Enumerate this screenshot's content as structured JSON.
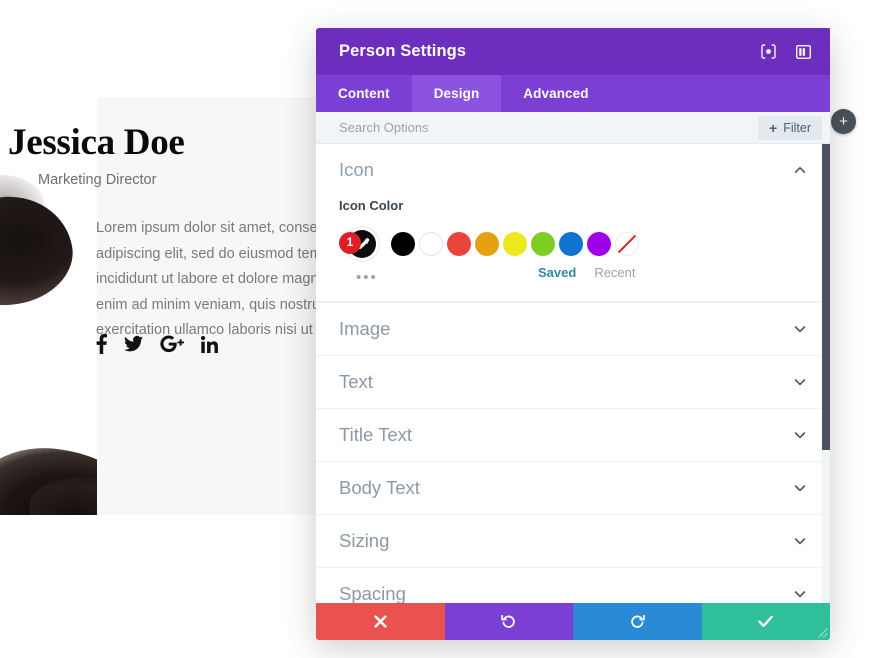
{
  "preview": {
    "person": {
      "name": "Jessica Doe",
      "role": "Marketing Director",
      "bio": "Lorem ipsum dolor sit amet, consectetur adipiscing elit, sed do eiusmod tempor incididunt ut labore et dolore magna aliqua. Ut enim ad minim veniam, quis nostrud exercitation ullamco laboris nisi ut aliquip ex ea commodo consequat",
      "social": [
        {
          "icon": "facebook-icon",
          "name": "Facebook"
        },
        {
          "icon": "twitter-icon",
          "name": "Twitter"
        },
        {
          "icon": "google-plus-icon",
          "name": "Google Plus"
        },
        {
          "icon": "linkedin-icon",
          "name": "LinkedIn"
        }
      ]
    },
    "add_button_label": "+"
  },
  "modal": {
    "title": "Person Settings",
    "header_icons": [
      {
        "icon": "focus-icon",
        "name": "Focus"
      },
      {
        "icon": "layout-panel-icon",
        "name": "Layout"
      }
    ],
    "tabs": [
      {
        "label": "Content",
        "active": false
      },
      {
        "label": "Design",
        "active": true
      },
      {
        "label": "Advanced",
        "active": false
      }
    ],
    "search": {
      "placeholder": "Search Options",
      "value": ""
    },
    "filter": {
      "label": "Filter",
      "plus": "+"
    },
    "icon_section": {
      "title": "Icon",
      "expanded": true,
      "field_label": "Icon Color",
      "selected_color": "#000000",
      "badge_count": "1",
      "more_dots": "•••",
      "swatches": [
        {
          "name": "black",
          "color": "#000000"
        },
        {
          "name": "white",
          "color": "#ffffff"
        },
        {
          "name": "red",
          "color": "#e8453c"
        },
        {
          "name": "orange",
          "color": "#e3a011"
        },
        {
          "name": "yellow",
          "color": "#ece81e"
        },
        {
          "name": "green",
          "color": "#7ccf22"
        },
        {
          "name": "blue",
          "color": "#1274ce"
        },
        {
          "name": "purple",
          "color": "#9d00e8"
        },
        {
          "name": "transparent",
          "color": "none"
        }
      ],
      "palette_tabs": [
        {
          "label": "Saved",
          "active": true
        },
        {
          "label": "Recent",
          "active": false
        }
      ]
    },
    "sections": [
      {
        "label": "Image"
      },
      {
        "label": "Text"
      },
      {
        "label": "Title Text"
      },
      {
        "label": "Body Text"
      },
      {
        "label": "Sizing"
      },
      {
        "label": "Spacing"
      }
    ],
    "actions": [
      {
        "name": "cancel",
        "icon": "close-icon",
        "color": "#e9524e"
      },
      {
        "name": "undo",
        "icon": "undo-icon",
        "color": "#7b3fd4"
      },
      {
        "name": "redo",
        "icon": "redo-icon",
        "color": "#2b8ad6"
      },
      {
        "name": "save",
        "icon": "checkmark-icon",
        "color": "#2fc09b"
      }
    ]
  }
}
